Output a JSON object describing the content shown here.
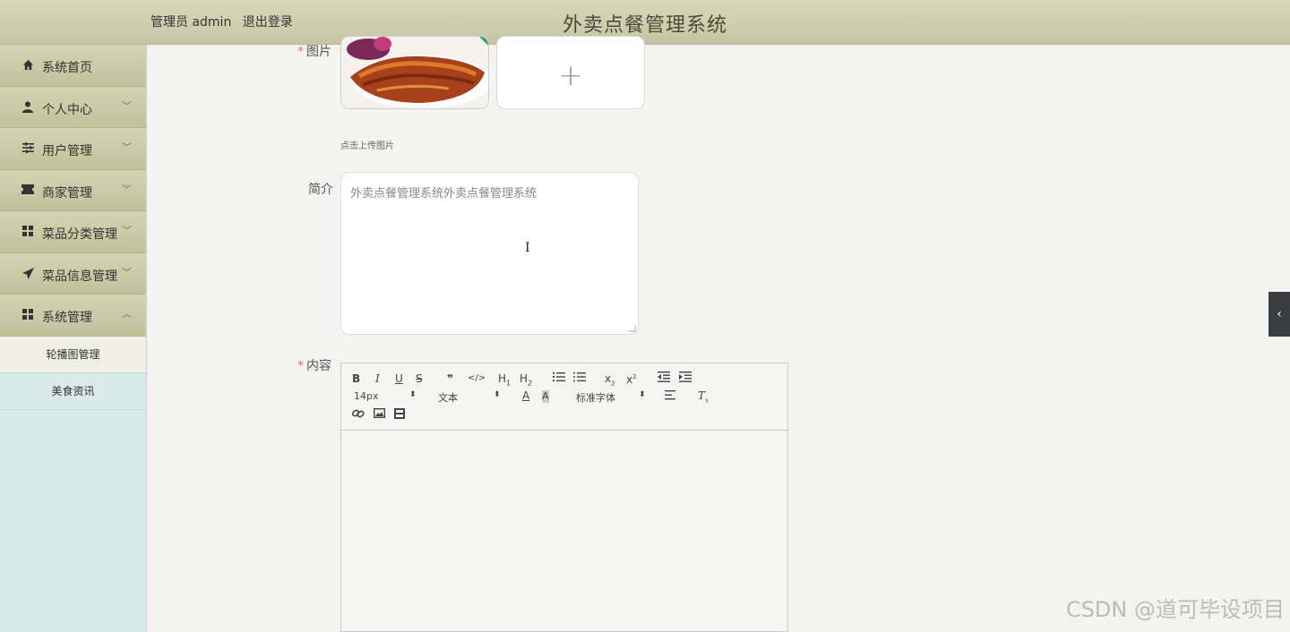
{
  "header": {
    "user_role": "管理员 admin",
    "logout_label": "退出登录",
    "app_title": "外卖点餐管理系统"
  },
  "sidebar": {
    "items": [
      {
        "label": "系统首页",
        "icon": "home-icon",
        "expandable": false
      },
      {
        "label": "个人中心",
        "icon": "user-icon",
        "expandable": true
      },
      {
        "label": "用户管理",
        "icon": "sliders-icon",
        "expandable": true
      },
      {
        "label": "商家管理",
        "icon": "ticket-icon",
        "expandable": true
      },
      {
        "label": "菜品分类管理",
        "icon": "grid-icon",
        "expandable": true
      },
      {
        "label": "菜品信息管理",
        "icon": "send-icon",
        "expandable": true
      },
      {
        "label": "系统管理",
        "icon": "grid-icon",
        "expandable": true,
        "expanded": true
      }
    ],
    "submenu": [
      {
        "label": "轮播图管理",
        "active": true
      },
      {
        "label": "美食资讯",
        "active": false
      }
    ]
  },
  "form": {
    "image_label": "图片",
    "upload_tip": "点击上传图片",
    "summary_label": "简介",
    "summary_value": "外卖点餐管理系统外卖点餐管理系统",
    "content_label": "内容"
  },
  "editor": {
    "font_size": "14px",
    "header_select": "文本",
    "font_family": "标准字体"
  },
  "watermark": "CSDN @道可毕设项目",
  "colors": {
    "header_bg": "#d0cfae",
    "sidebar_bg": "#d9eae8",
    "required": "#f56c6c"
  }
}
